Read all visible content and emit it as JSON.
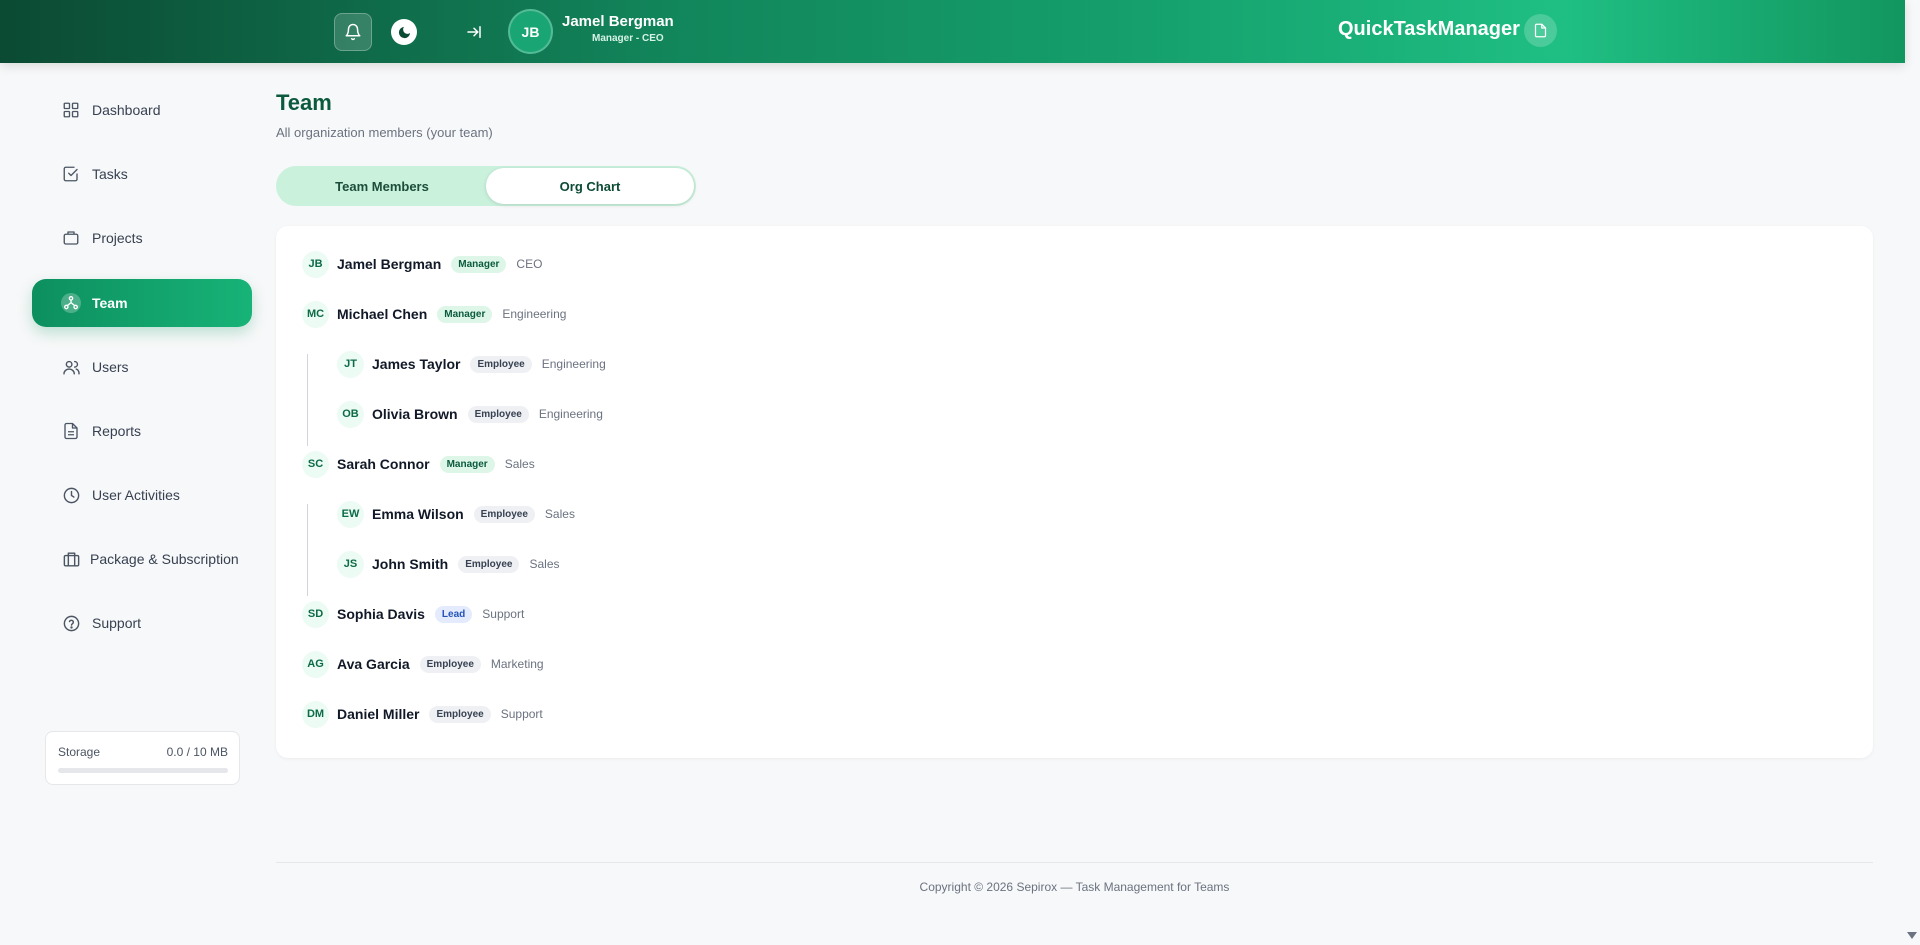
{
  "header": {
    "user_initials": "JB",
    "user_name": "Jamel Bergman",
    "user_role": "Manager - CEO",
    "brand": "QuickTaskManager",
    "gradient_colors": [
      "#0b4a33",
      "#15a06d",
      "#1fbf83"
    ]
  },
  "sidebar": {
    "items": [
      {
        "label": "Dashboard",
        "icon": "grid-icon",
        "active": false
      },
      {
        "label": "Tasks",
        "icon": "check-square-icon",
        "active": false
      },
      {
        "label": "Projects",
        "icon": "briefcase-icon",
        "active": false
      },
      {
        "label": "Team",
        "icon": "team-network-icon",
        "active": true
      },
      {
        "label": "Users",
        "icon": "users-icon",
        "active": false
      },
      {
        "label": "Reports",
        "icon": "document-icon",
        "active": false
      },
      {
        "label": "User Activities",
        "icon": "clock-icon",
        "active": false
      },
      {
        "label": "Package & Subscription",
        "icon": "package-icon",
        "active": false
      },
      {
        "label": "Support",
        "icon": "help-circle-icon",
        "active": false
      }
    ],
    "storage": {
      "label": "Storage",
      "value": "0.0 / 10 MB",
      "used_fraction": 0.0
    }
  },
  "main": {
    "title": "Team",
    "subtitle": "All organization members (your team)",
    "tabs": [
      {
        "label": "Team Members",
        "active": false
      },
      {
        "label": "Org Chart",
        "active": true
      }
    ],
    "members": [
      {
        "initials": "JB",
        "name": "Jamel Bergman",
        "role": "Manager",
        "dept": "CEO",
        "level": 0
      },
      {
        "initials": "MC",
        "name": "Michael Chen",
        "role": "Manager",
        "dept": "Engineering",
        "level": 0
      },
      {
        "initials": "JT",
        "name": "James Taylor",
        "role": "Employee",
        "dept": "Engineering",
        "level": 1
      },
      {
        "initials": "OB",
        "name": "Olivia Brown",
        "role": "Employee",
        "dept": "Engineering",
        "level": 1
      },
      {
        "initials": "SC",
        "name": "Sarah Connor",
        "role": "Manager",
        "dept": "Sales",
        "level": 0
      },
      {
        "initials": "EW",
        "name": "Emma Wilson",
        "role": "Employee",
        "dept": "Sales",
        "level": 1
      },
      {
        "initials": "JS",
        "name": "John Smith",
        "role": "Employee",
        "dept": "Sales",
        "level": 1
      },
      {
        "initials": "SD",
        "name": "Sophia Davis",
        "role": "Lead",
        "dept": "Support",
        "level": 0
      },
      {
        "initials": "AG",
        "name": "Ava Garcia",
        "role": "Employee",
        "dept": "Marketing",
        "level": 0
      },
      {
        "initials": "DM",
        "name": "Daniel Miller",
        "role": "Employee",
        "dept": "Support",
        "level": 0
      }
    ]
  },
  "footer": {
    "text": "Copyright © 2026 Sepirox — Task Management for Teams"
  }
}
